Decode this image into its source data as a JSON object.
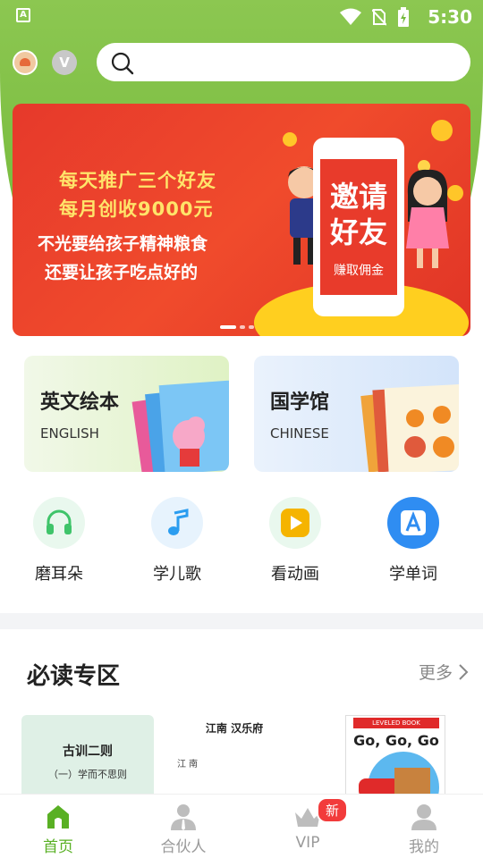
{
  "status_bar": {
    "time": "5:30",
    "app_icon_letter": "A"
  },
  "search": {
    "placeholder": ""
  },
  "banner": {
    "line1": "每天推广三个好友",
    "line2": "每月创收9000元",
    "line3": "不光要给孩子精神粮食",
    "line4": "还要让孩子吃点好的",
    "phone_title": "邀请好友",
    "phone_sub": "赚取佣金",
    "dots": 3,
    "active_dot": 1
  },
  "category_cards": [
    {
      "title": "英文绘本",
      "subtitle": "ENGLISH"
    },
    {
      "title": "国学馆",
      "subtitle": "CHINESE"
    }
  ],
  "functions": [
    {
      "label": "磨耳朵",
      "icon": "headphones-icon",
      "color": "#3fc46a"
    },
    {
      "label": "学儿歌",
      "icon": "music-note-icon",
      "color": "#2b9df0"
    },
    {
      "label": "看动画",
      "icon": "play-icon",
      "color": "#f5b400"
    },
    {
      "label": "学单词",
      "icon": "letter-a-icon",
      "color": "#2f8df2"
    }
  ],
  "section": {
    "title": "必读专区",
    "more": "更多"
  },
  "books": [
    {
      "title": "古训二则",
      "line": "（一）学而不思则"
    },
    {
      "title": "江南 汉乐府",
      "line": "江 南"
    },
    {
      "title": "Go, Go, Go",
      "tag": "LEVELED BOOK"
    }
  ],
  "tabbar": {
    "items": [
      {
        "label": "首页",
        "icon": "home-icon",
        "active": true
      },
      {
        "label": "合伙人",
        "icon": "partner-icon",
        "active": false
      },
      {
        "label": "VIP",
        "icon": "crown-icon",
        "active": false
      },
      {
        "label": "我的",
        "icon": "profile-icon",
        "active": false
      }
    ],
    "vip_badge": "新"
  },
  "colors": {
    "brand_green": "#74b93a",
    "active_tab": "#59b024",
    "banner_red": "#e6392b"
  }
}
